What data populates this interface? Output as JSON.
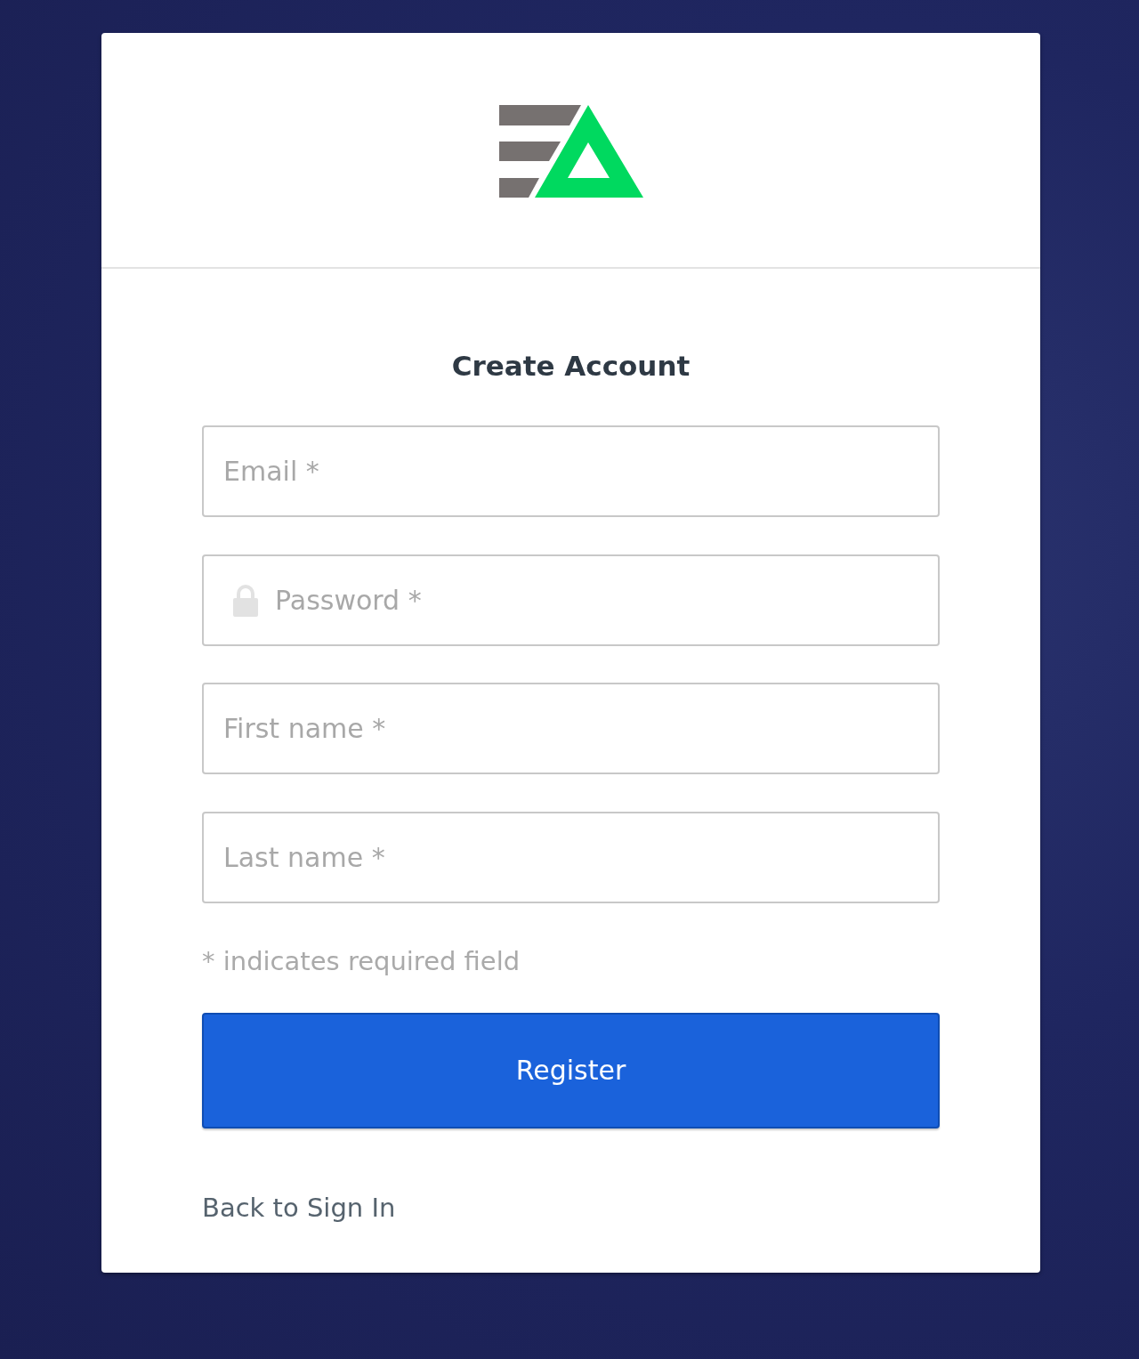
{
  "title": "Create Account",
  "fields": [
    {
      "kind": "email",
      "placeholder": "Email *"
    },
    {
      "kind": "password",
      "placeholder": "Password *"
    },
    {
      "kind": "text",
      "placeholder": "First name *"
    },
    {
      "kind": "text",
      "placeholder": "Last name *"
    }
  ],
  "required_note": "* indicates required field",
  "submit_button": {
    "label": "Register"
  },
  "back_link": {
    "label": "Back to Sign In"
  }
}
